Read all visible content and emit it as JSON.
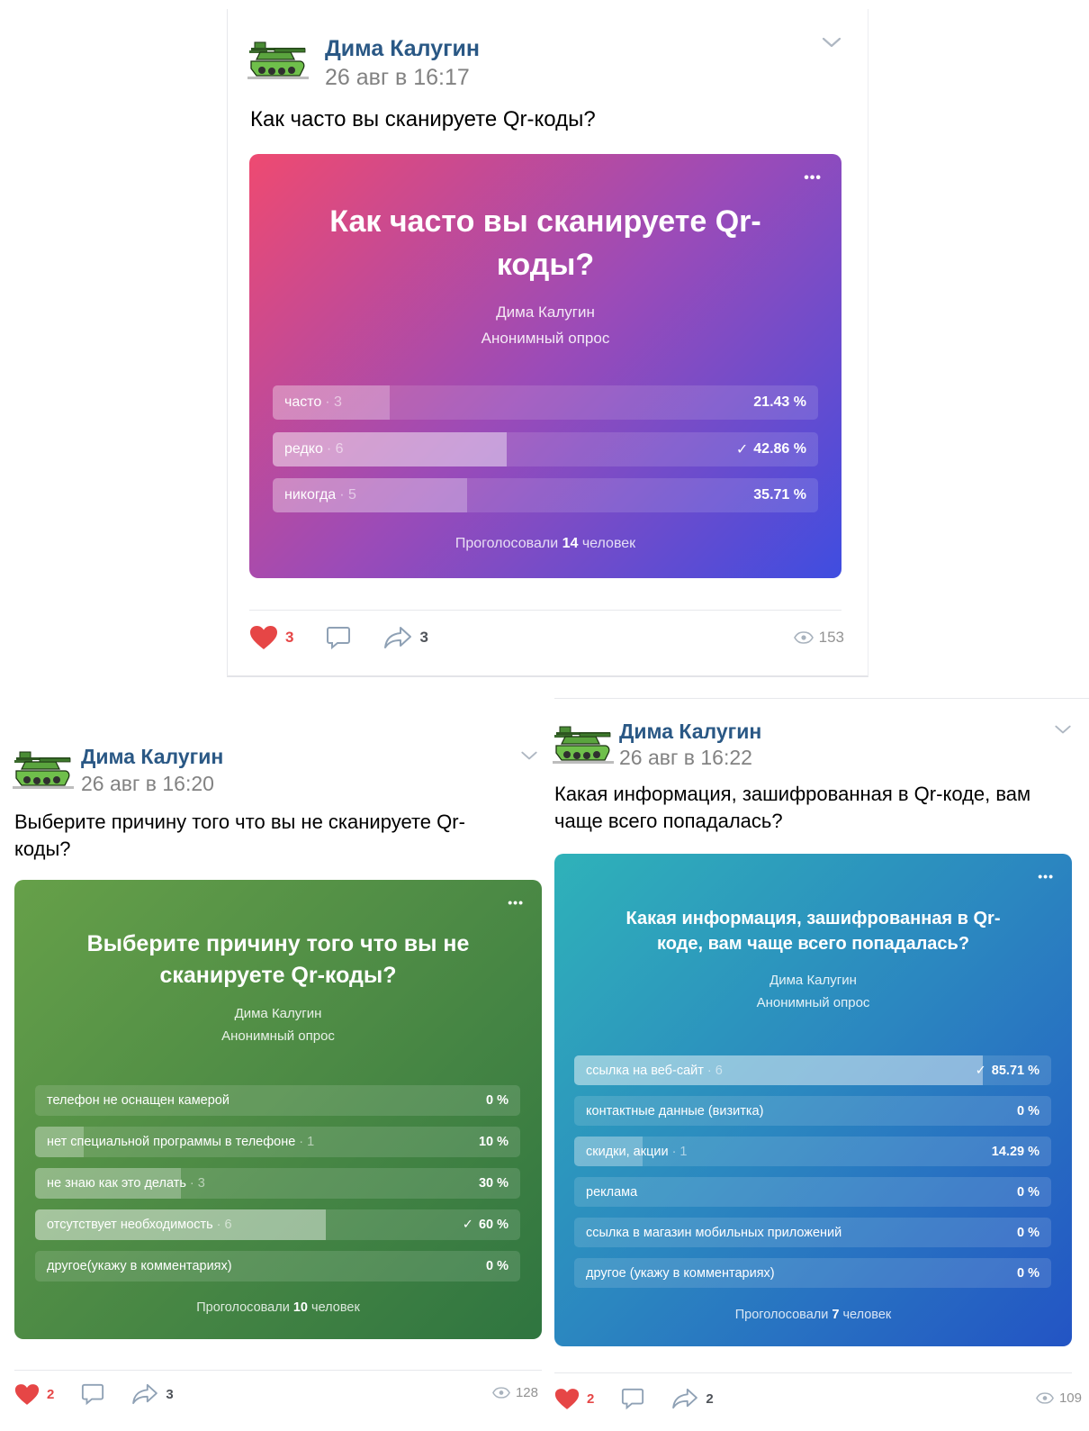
{
  "posts": [
    {
      "author": "Дима Калугин",
      "date": "26 авг в 16:17",
      "question": "Как часто вы сканируете Qr-коды?",
      "poll": {
        "title": "Как часто вы сканируете Qr-коды?",
        "author": "Дима Калугин",
        "type": "Анонимный опрос",
        "options": [
          {
            "label": "часто",
            "count": "· 3",
            "percent": "21.43 %",
            "fraction": 0.2143,
            "chosen": false
          },
          {
            "label": "редко",
            "count": "· 6",
            "percent": "42.86 %",
            "fraction": 0.4286,
            "chosen": true
          },
          {
            "label": "никогда",
            "count": "· 5",
            "percent": "35.71 %",
            "fraction": 0.3571,
            "chosen": false
          }
        ],
        "total_prefix": "Проголосовали",
        "total_count": "14",
        "total_suffix": "человек",
        "gradient": [
          "#ee4a71",
          "#9b4bb8",
          "#3f4de0"
        ]
      },
      "likes": "3",
      "shares": "3",
      "views": "153"
    },
    {
      "author": "Дима Калугин",
      "date": "26 авг в 16:20",
      "question": "Выберите причину того что вы не сканируете Qr-коды?",
      "poll": {
        "title": "Выберите причину того что вы не сканируете Qr-коды?",
        "author": "Дима Калугин",
        "type": "Анонимный опрос",
        "options": [
          {
            "label": "телефон не оснащен камерой",
            "count": "",
            "percent": "0 %",
            "fraction": 0,
            "chosen": false
          },
          {
            "label": "нет специальной программы в телефоне",
            "count": "· 1",
            "percent": "10 %",
            "fraction": 0.1,
            "chosen": false
          },
          {
            "label": "не знаю как это делать",
            "count": "· 3",
            "percent": "30 %",
            "fraction": 0.3,
            "chosen": false
          },
          {
            "label": "отсутствует необходимость",
            "count": "· 6",
            "percent": "60 %",
            "fraction": 0.6,
            "chosen": true
          },
          {
            "label": "другое(укажу в комментариях)",
            "count": "",
            "percent": "0 %",
            "fraction": 0,
            "chosen": false
          }
        ],
        "total_prefix": "Проголосовали",
        "total_count": "10",
        "total_suffix": "человек",
        "gradient": [
          "#66a049",
          "#4c8a45",
          "#2f7540"
        ]
      },
      "likes": "2",
      "shares": "3",
      "views": "128"
    },
    {
      "author": "Дима Калугин",
      "date": "26 авг в 16:22",
      "question": "Какая информация, зашифрованная в Qr-коде, вам чаще всего попадалась?",
      "poll": {
        "title": "Какая информация, зашифрованная в Qr-коде, вам чаще всего попадалась?",
        "author": "Дима Калугин",
        "type": "Анонимный опрос",
        "options": [
          {
            "label": "ссылка на веб-сайт",
            "count": "· 6",
            "percent": "85.71 %",
            "fraction": 0.8571,
            "chosen": true
          },
          {
            "label": "контактные данные (визитка)",
            "count": "",
            "percent": "0 %",
            "fraction": 0,
            "chosen": false
          },
          {
            "label": "скидки, акции",
            "count": "· 1",
            "percent": "14.29 %",
            "fraction": 0.1429,
            "chosen": false
          },
          {
            "label": "реклама",
            "count": "",
            "percent": "0 %",
            "fraction": 0,
            "chosen": false
          },
          {
            "label": "ссылка в магазин мобильных приложений",
            "count": "",
            "percent": "0 %",
            "fraction": 0,
            "chosen": false
          },
          {
            "label": "другое (укажу в комментариях)",
            "count": "",
            "percent": "0 %",
            "fraction": 0,
            "chosen": false
          }
        ],
        "total_prefix": "Проголосовали",
        "total_count": "7",
        "total_suffix": "человек",
        "gradient": [
          "#2fb2b9",
          "#2b86c0",
          "#2354c4"
        ]
      },
      "likes": "2",
      "shares": "2",
      "views": "109"
    }
  ],
  "icons": {
    "avatar": "tank-avatar-icon",
    "menu": "chevron-down-icon",
    "poll_menu": "more-dots-icon",
    "like": "heart-icon",
    "comment": "comment-icon",
    "share": "share-icon",
    "views": "eye-icon",
    "check": "checkmark-icon"
  },
  "poll_menu_glyph": "•••",
  "check_glyph": "✓"
}
